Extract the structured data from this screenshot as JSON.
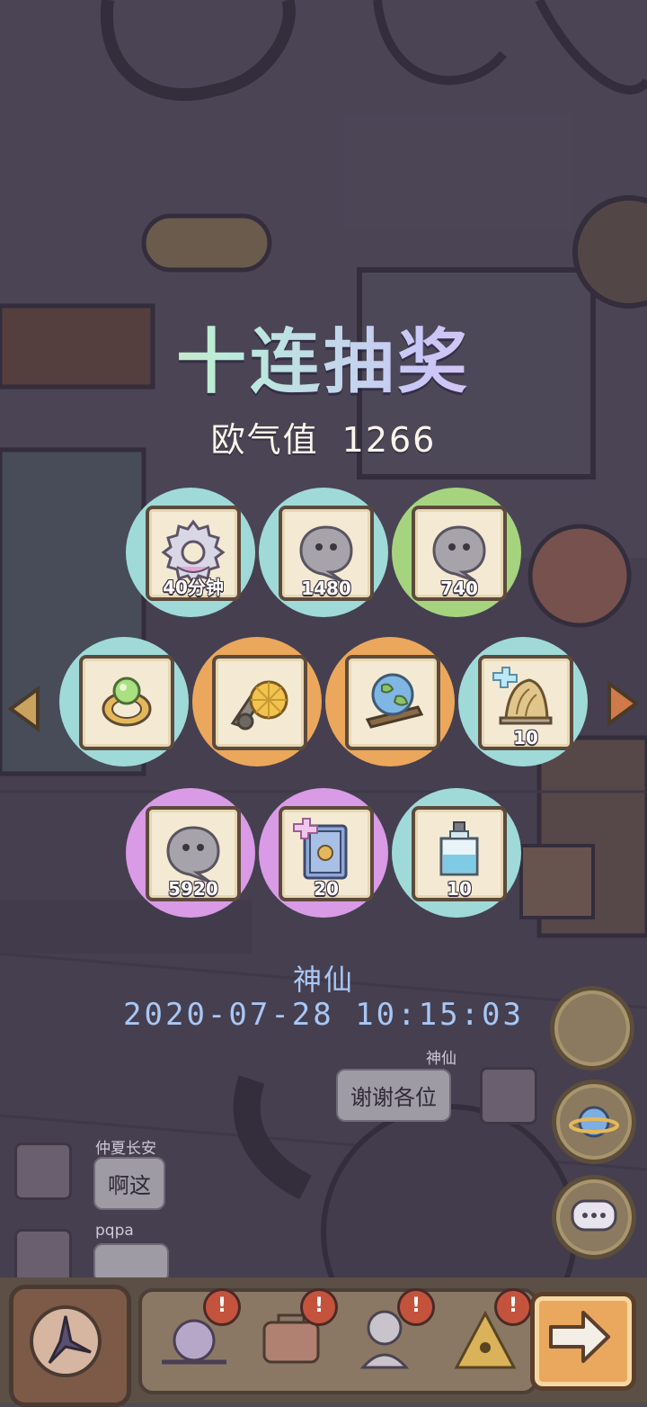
{
  "title": "十连抽奖",
  "luck": {
    "label": "欧气值",
    "value": "1266"
  },
  "rewards": [
    {
      "id": "gear",
      "color": "teal",
      "count": "40分钟",
      "icon": "gear-icon"
    },
    {
      "id": "bubble1",
      "color": "teal",
      "count": "1480",
      "icon": "chat-bubble-icon"
    },
    {
      "id": "bubble2",
      "color": "green",
      "count": "740",
      "icon": "chat-bubble-icon"
    },
    {
      "id": "gem-ring",
      "color": "teal",
      "count": "",
      "icon": "gem-ring-icon"
    },
    {
      "id": "lemon-device",
      "color": "orange",
      "count": "",
      "icon": "lemon-device-icon"
    },
    {
      "id": "globe",
      "color": "orange",
      "count": "",
      "icon": "globe-icon"
    },
    {
      "id": "fossil",
      "color": "teal",
      "count": "10",
      "icon": "fossil-icon",
      "sparkle": true
    },
    {
      "id": "bubble3",
      "color": "purple",
      "count": "5920",
      "icon": "chat-bubble-icon"
    },
    {
      "id": "book",
      "color": "purple",
      "count": "20",
      "icon": "book-icon",
      "sparkle": true
    },
    {
      "id": "potion",
      "color": "teal",
      "count": "10",
      "icon": "potion-bottle-icon"
    }
  ],
  "winner": {
    "name": "神仙",
    "time": "2020-07-28 10:15:03"
  },
  "chat": [
    {
      "name": "神仙",
      "text": "谢谢各位"
    },
    {
      "name": "仲夏长安",
      "text": "啊这"
    },
    {
      "name": "pqpa",
      "text": ""
    }
  ],
  "bottom_badges": [
    "!",
    "!",
    "!",
    "!"
  ],
  "colors": {
    "teal": "#9fdad8",
    "green": "#a6d47e",
    "orange": "#eba75b",
    "purple": "#d99ae6"
  }
}
